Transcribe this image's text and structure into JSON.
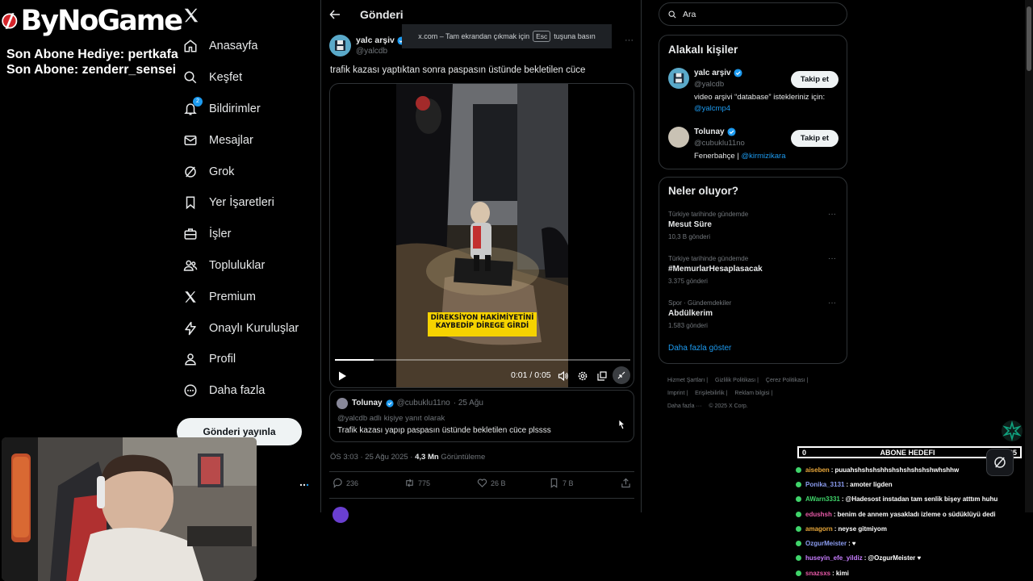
{
  "overlay": {
    "brand": "ByNoGame",
    "last_gift": "Son Abone Hediye: pertkafa",
    "last_sub": "Son Abone: zenderr_sensei",
    "goal_current": "0",
    "goal_label": "ABONE HEDEFI",
    "goal_target": "25"
  },
  "nav": {
    "items": [
      {
        "label": "Anasayfa",
        "icon": "home-icon"
      },
      {
        "label": "Keşfet",
        "icon": "search-icon"
      },
      {
        "label": "Bildirimler",
        "icon": "bell-icon",
        "badge": "2"
      },
      {
        "label": "Mesajlar",
        "icon": "mail-icon"
      },
      {
        "label": "Grok",
        "icon": "grok-icon"
      },
      {
        "label": "Yer İşaretleri",
        "icon": "bookmark-icon"
      },
      {
        "label": "İşler",
        "icon": "briefcase-icon"
      },
      {
        "label": "Topluluklar",
        "icon": "people-icon"
      },
      {
        "label": "Premium",
        "icon": "x-icon"
      },
      {
        "label": "Onaylı Kuruluşlar",
        "icon": "lightning-icon"
      },
      {
        "label": "Profil",
        "icon": "person-icon"
      },
      {
        "label": "Daha fazla",
        "icon": "more-circle-icon"
      }
    ],
    "post_button": "Gönderi yayınla"
  },
  "post": {
    "page_title": "Gönderi",
    "fullscreen_banner_before": "x.com – Tam ekrandan çıkmak için",
    "fullscreen_banner_key": "Esc",
    "fullscreen_banner_after": "tuşuna basın",
    "author_name": "yalc arşiv",
    "author_handle": "@yalcdb",
    "text": "trafik kazası yaptıktan sonra paspasın üstünde bekletilen cüce",
    "video": {
      "caption_line1": "DİREKSİYON HAKİMİYETİNİ",
      "caption_line2": "KAYBEDİP DİREGE GİRDİ",
      "time": "0:01 / 0:05",
      "progress": 0.13
    },
    "reply": {
      "name": "Tolunay",
      "handle": "@cubuklu11no",
      "date": "· 25 Ağu",
      "replying_to": "@yalcdb adlı kişiye yanıt olarak",
      "text": "Trafik kazası yapıp paspasın üstünde bekletilen cüce plssss"
    },
    "meta_time": "ÖS 3:03 · 25 Ağu 2025 · ",
    "meta_views": "4,3 Mn",
    "meta_views_label": " Görüntüleme",
    "replies": "236",
    "reposts": "775",
    "likes": "26 B",
    "bookmarks": "7 B"
  },
  "right": {
    "search_placeholder": "Ara",
    "related_title": "Alakalı kişiler",
    "people": [
      {
        "name": "yalc arşiv",
        "handle": "@yalcdb",
        "bio_text": "video arşivi “database” istekleriniz için:",
        "bio_link": "@yalcmp4",
        "follow": "Takip et"
      },
      {
        "name": "Tolunay",
        "handle": "@cubuklu11no",
        "bio_text": "Fenerbahçe | ",
        "bio_link": "@kirmizikara",
        "follow": "Takip et"
      }
    ],
    "trends_title": "Neler oluyor?",
    "trends": [
      {
        "context": "Türkiye tarihinde gündemde",
        "name": "Mesut Süre",
        "count": "10,3 B gönderi"
      },
      {
        "context": "Türkiye tarihinde gündemde",
        "name": "#MemurlarHesaplasacak",
        "count": "3.375 gönderi"
      },
      {
        "context": "Spor · Gündemdekiler",
        "name": "Abdülkerim",
        "count": "1.583 gönderi"
      }
    ],
    "show_more": "Daha fazla göster",
    "footer": [
      "Hizmet Şartları |",
      "Gizlilik Politikası |",
      "Çerez Politikası |",
      "Imprint |",
      "Erişilebilirlik |",
      "Reklam bilgisi |",
      "Daha fazla ···",
      "© 2025 X Corp."
    ]
  },
  "chat": [
    {
      "user": "aiseben",
      "color": "#e8a73a",
      "msg": "puuahshshshshhshshshshshshwhshhw"
    },
    {
      "user": "Ponika_3131",
      "color": "#8b9cf0",
      "msg": "amoter ligden"
    },
    {
      "user": "AWarn3331",
      "color": "#3fd46a",
      "msg": "@Hadesost instadan tam senlik bişey atttım huhu"
    },
    {
      "user": "edushsh",
      "color": "#e85aa8",
      "msg": "benim de annem yasakladı izleme o südüklüyü dedi"
    },
    {
      "user": "amagorn",
      "color": "#e8a73a",
      "msg": "neyse gitmiyom"
    },
    {
      "user": "OzgurMeister",
      "color": "#8b9cf0",
      "msg": "♥"
    },
    {
      "user": "huseyin_efe_yildiz",
      "color": "#c77dff",
      "msg": "@OzgurMeister ♥"
    },
    {
      "user": "snazsxs",
      "color": "#e85aa8",
      "msg": "kimi"
    }
  ]
}
